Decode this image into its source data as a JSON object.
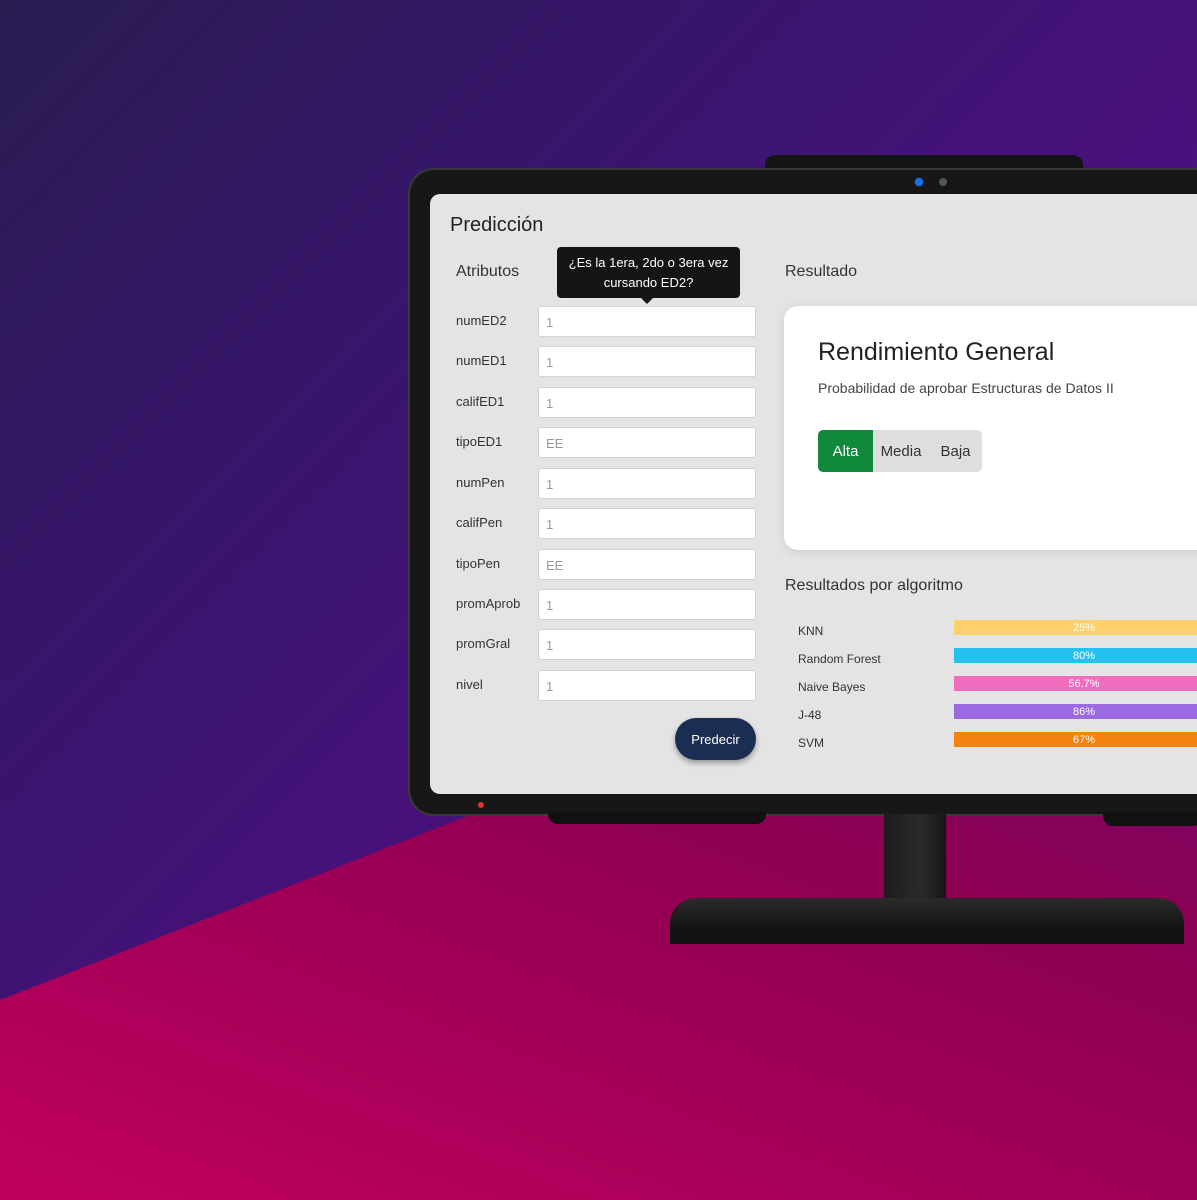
{
  "app": {
    "page_title": "Predicción",
    "attributes_title": "Atributos",
    "result_title": "Resultado",
    "tooltip": "¿Es la 1era, 2do o 3era vez cursando ED2?"
  },
  "form": {
    "fields": [
      {
        "label": "numED2",
        "value": "1"
      },
      {
        "label": "numED1",
        "value": "1"
      },
      {
        "label": "califED1",
        "value": "1"
      },
      {
        "label": "tipoED1",
        "value": "EE"
      },
      {
        "label": "numPen",
        "value": "1"
      },
      {
        "label": "califPen",
        "value": "1"
      },
      {
        "label": "tipoPen",
        "value": "EE"
      },
      {
        "label": "promAprob",
        "value": "1"
      },
      {
        "label": "promGral",
        "value": "1"
      },
      {
        "label": "nivel",
        "value": "1"
      }
    ],
    "submit_label": "Predecir"
  },
  "result": {
    "card_title": "Rendimiento General",
    "card_subtitle": "Probabilidad de aprobar Estructuras de Datos II",
    "levels": [
      "Alta",
      "Media",
      "Baja"
    ],
    "selected_level": "Alta",
    "accent": "#11893d"
  },
  "algorithms": {
    "title": "Resultados por algoritmo",
    "items": [
      {
        "name": "KNN",
        "value_label": "25%",
        "color": "#fdd06c"
      },
      {
        "name": "Random Forest",
        "value_label": "80%",
        "color": "#25c0ef"
      },
      {
        "name": "Naive Bayes",
        "value_label": "56.7%",
        "color": "#f26cbd"
      },
      {
        "name": "J-48",
        "value_label": "86%",
        "color": "#9b6ae0"
      },
      {
        "name": "SVM",
        "value_label": "67%",
        "color": "#f5810e"
      }
    ]
  }
}
